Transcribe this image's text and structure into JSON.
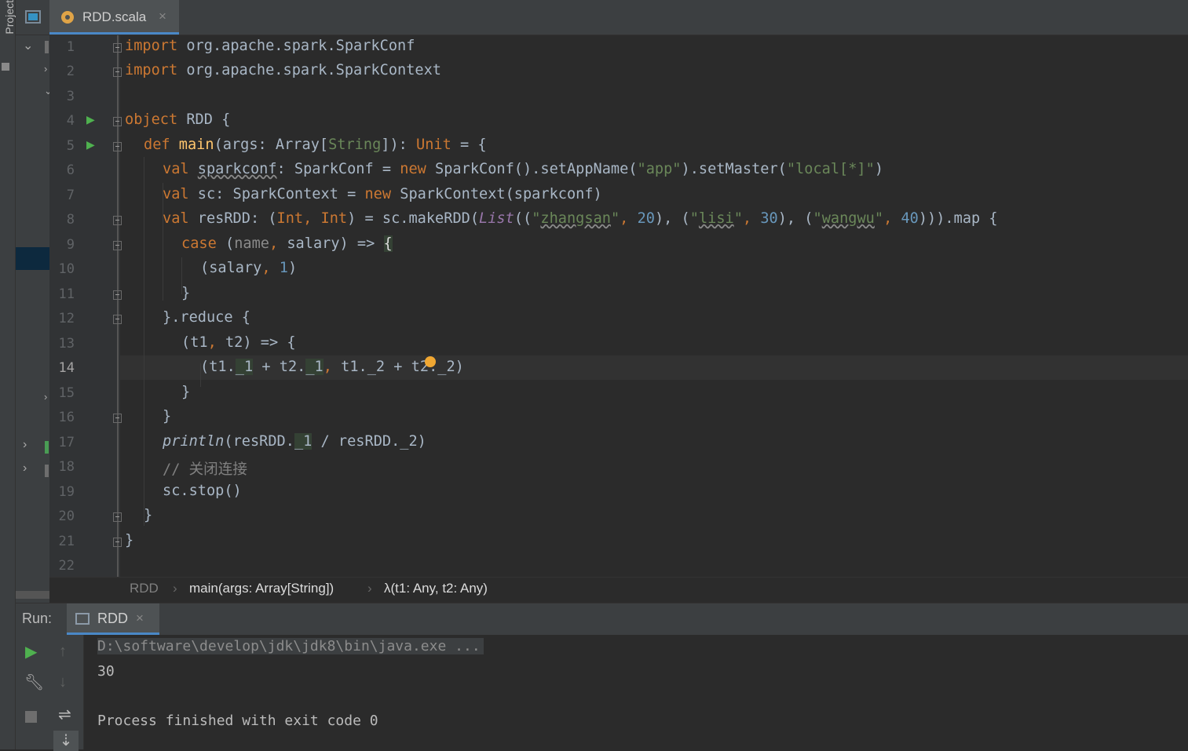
{
  "sidebar": {
    "project_label": "Project"
  },
  "editor_tab": {
    "filename": "RDD.scala",
    "close": "×"
  },
  "gutter": {
    "line_numbers": [
      "1",
      "2",
      "3",
      "4",
      "5",
      "6",
      "7",
      "8",
      "9",
      "10",
      "11",
      "12",
      "13",
      "14",
      "15",
      "16",
      "17",
      "18",
      "19",
      "20",
      "21",
      "22"
    ],
    "current_line": "14"
  },
  "code": {
    "l1": [
      "import",
      " org.apache.spark.SparkConf"
    ],
    "l2": [
      "import",
      " org.apache.spark.SparkContext"
    ],
    "l4": [
      "object",
      " RDD {"
    ],
    "l5": [
      "def ",
      "main",
      "(args: Array[",
      "String",
      "]): ",
      "Unit",
      " = {"
    ],
    "l6": [
      "val ",
      "sparkconf",
      ": SparkConf = ",
      "new ",
      "SparkConf().setAppName(",
      "\"app\"",
      ").setMaster(",
      "\"local[*]\"",
      ")"
    ],
    "l7": [
      "val ",
      "sc: SparkContext = ",
      "new ",
      "SparkContext(sparkconf)"
    ],
    "l8": [
      "val ",
      "resRDD: (",
      "Int",
      ", ",
      "Int",
      ") = sc.makeRDD(",
      "List",
      "((",
      "\"",
      "zhangsan",
      "\"",
      ", ",
      "20",
      "), (",
      "\"",
      "lisi",
      "\"",
      ", ",
      "30",
      "), (",
      "\"",
      "wangwu",
      "\"",
      ", ",
      "40",
      "))).map {"
    ],
    "l9": [
      "case ",
      "(",
      "name",
      ", ",
      "salary) => ",
      "{"
    ],
    "l10": [
      "(salary",
      ", ",
      "1",
      ")"
    ],
    "l11": [
      "}"
    ],
    "l12": [
      "}.reduce {"
    ],
    "l13": [
      "(t1",
      ", ",
      "t2) => {"
    ],
    "l14": [
      "(t1.",
      "_1",
      " + t2.",
      "_1",
      ", ",
      "t1._2 + t2._2)"
    ],
    "l15": [
      "}"
    ],
    "l16": [
      "}"
    ],
    "l17": [
      "println",
      "(resRDD.",
      "_1",
      " / resRDD._2)"
    ],
    "l18": [
      "// 关闭连接"
    ],
    "l19": [
      "sc.stop()"
    ],
    "l20": [
      "}"
    ],
    "l21": [
      "}"
    ]
  },
  "breadcrumbs": [
    "RDD",
    "main(args: Array[String])",
    "λ(t1: Any, t2: Any)"
  ],
  "run_panel": {
    "label": "Run:",
    "tab": "RDD",
    "close": "×"
  },
  "console": {
    "command": "D:\\software\\develop\\jdk\\jdk8\\bin\\java.exe ...",
    "output": "30",
    "finish": "Process finished with exit code 0"
  },
  "icons": [
    "window-icon",
    "scala-file-icon",
    "run-gutter-icon",
    "fold-icon",
    "bulb-icon",
    "run-icon",
    "wrench-icon",
    "stop-icon",
    "up-arrow-icon",
    "down-arrow-icon",
    "soft-wrap-icon",
    "scroll-end-icon"
  ]
}
